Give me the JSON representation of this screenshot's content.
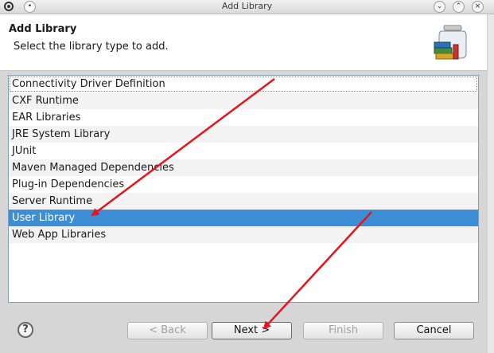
{
  "window": {
    "title": "Add Library",
    "menu_icon": "circle-dot-icon",
    "controls": [
      "minimize-icon",
      "maximize-icon",
      "close-icon"
    ]
  },
  "header": {
    "title": "Add Library",
    "description": "Select the library type to add.",
    "icon": "library-jar-icon"
  },
  "library_types": [
    "Connectivity Driver Definition",
    "CXF Runtime",
    "EAR Libraries",
    "JRE System Library",
    "JUnit",
    "Maven Managed Dependencies",
    "Plug-in Dependencies",
    "Server Runtime",
    "User Library",
    "Web App Libraries"
  ],
  "selected_library": "User Library",
  "footer": {
    "help_icon": "help-icon",
    "back_label": "< Back",
    "next_label": "Next >",
    "finish_label": "Finish",
    "cancel_label": "Cancel"
  },
  "colors": {
    "selection": "#3c8fd6",
    "annotation_arrow": "#e8141b",
    "list_border": "#7f9db9"
  }
}
